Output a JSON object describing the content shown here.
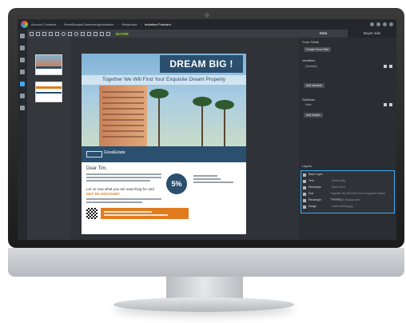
{
  "breadcrumb": {
    "items": [
      "Account Contacts",
      "GreatEscapeCustomerAppreciation",
      "Storyboard",
      "Invitation Postcard"
    ]
  },
  "toolbar": {
    "buyer_label": "BUYER"
  },
  "panel": {
    "tabs": [
      {
        "label": "Data"
      },
      {
        "label": "Buyer side"
      }
    ],
    "form_fields": {
      "title": "Form Fields",
      "button": "Create Form Field"
    },
    "variables": {
      "title": "Variables",
      "item": "[Variable]",
      "button": "Add Variable"
    },
    "switches": {
      "title": "Switches",
      "item": "Main",
      "button": "Add Switch"
    },
    "layers": {
      "title": "Layers",
      "items": [
        {
          "type": "Base Layer",
          "desc": ""
        },
        {
          "type": "Text",
          "desc": "Dream Big"
        },
        {
          "type": "Rectangle",
          "desc": "Basic Rect"
        },
        {
          "type": "Text",
          "desc": "Together We Will Find Your Exquisite Dream Property"
        },
        {
          "type": "Rectangle",
          "desc": "Rectangle Background"
        },
        {
          "type": "Image",
          "desc": "hotel-building.jpg"
        }
      ]
    }
  },
  "postcard": {
    "headline": "DREAM BIG !",
    "tagline": "Together We Will Find Your Exquisite Dream Property",
    "brand": "GreatEstate",
    "salutation": "Dear Tim,",
    "offer_line": "Let us now what you are searching for and",
    "offer_highlight": "GET 5% DISCOUNT",
    "discount": "5%"
  },
  "colors": {
    "brand": "#2b4f6e",
    "accent": "#e07b1f",
    "buyer": "#9acd32",
    "selection": "#3fa9f5"
  }
}
